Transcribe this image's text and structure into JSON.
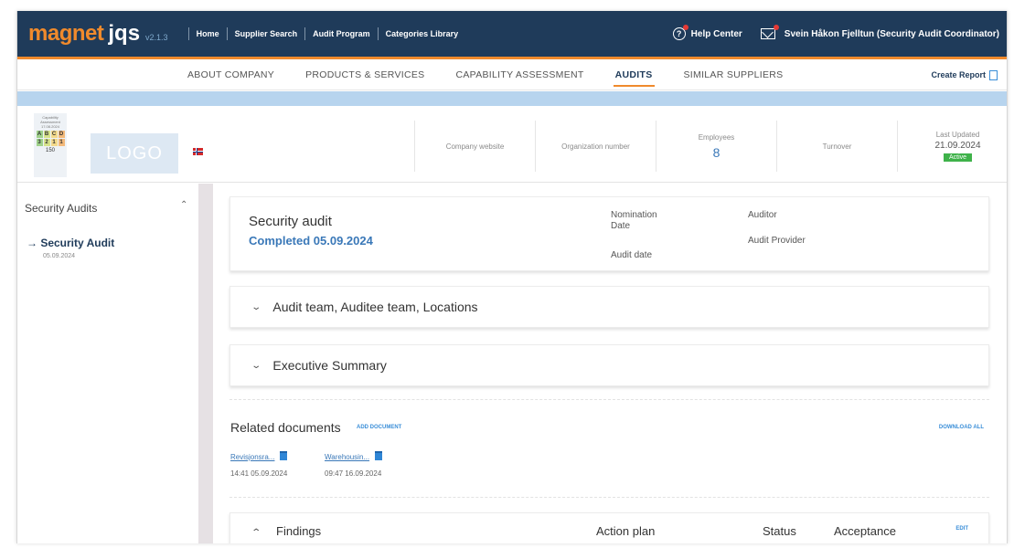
{
  "brand": {
    "word1": "magnet",
    "word2": "jqs",
    "version": "v2.1.3"
  },
  "topnav": [
    "Home",
    "Supplier Search",
    "Audit Program",
    "Categories Library"
  ],
  "topbar_right": {
    "help": "Help Center",
    "user": "Svein Håkon Fjelltun (Security Audit Coordinator)"
  },
  "tabs": [
    "ABOUT COMPANY",
    "PRODUCTS & SERVICES",
    "CAPABILITY ASSESSMENT",
    "AUDITS",
    "SIMILAR SUPPLIERS"
  ],
  "active_tab": "AUDITS",
  "create_report": "Create Report",
  "badge": {
    "title": "Capability Assessment",
    "date": "17.08.2024",
    "letters": [
      "A",
      "B",
      "C",
      "D"
    ],
    "numbers": [
      "3",
      "2",
      "1",
      "1"
    ],
    "score": "150"
  },
  "logo_text": "LOGO",
  "company_info": {
    "website_label": "Company website",
    "org_label": "Organization number",
    "employees_label": "Employees",
    "employees_value": "8",
    "turnover_label": "Turnover",
    "updated_label": "Last Updated",
    "updated_value": "21.09.2024",
    "status": "Active"
  },
  "sidebar": {
    "heading": "Security Audits",
    "item": "→ Security Audit",
    "item_date": "05.09.2024"
  },
  "audit": {
    "title": "Security audit",
    "status": "Completed 05.09.2024",
    "nomination_date": "Nomination Date",
    "audit_date": "Audit date",
    "auditor": "Auditor",
    "audit_provider": "Audit Provider"
  },
  "sections": {
    "team": "Audit team, Auditee team, Locations",
    "summary": "Executive Summary"
  },
  "related": {
    "title": "Related documents",
    "add": "ADD DOCUMENT",
    "download_all": "DOWNLOAD ALL",
    "docs": [
      {
        "name": "Revisjonsra...",
        "time": "14:41 05.09.2024"
      },
      {
        "name": "Warehousin...",
        "time": "09:47 16.09.2024"
      }
    ]
  },
  "findings": {
    "title": "Findings",
    "action_plan": "Action plan",
    "status": "Status",
    "acceptance": "Acceptance",
    "edit": "EDIT"
  },
  "colors": {
    "navy": "#1f3b5a",
    "orange": "#f08a2c",
    "link_blue": "#3a78b8",
    "active_green": "#3fb24a"
  }
}
